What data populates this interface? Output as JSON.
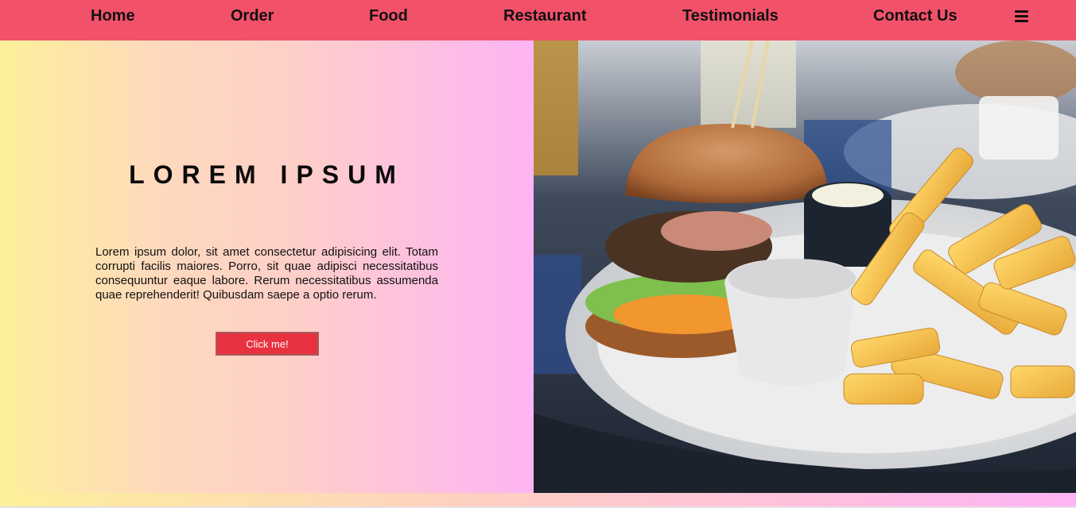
{
  "nav": {
    "items": [
      {
        "label": "Home"
      },
      {
        "label": "Order"
      },
      {
        "label": "Food"
      },
      {
        "label": "Restaurant"
      },
      {
        "label": "Testimonials"
      },
      {
        "label": "Contact Us"
      }
    ],
    "menu_icon": "hamburger-menu-icon"
  },
  "hero": {
    "title": "LOREM IPSUM",
    "paragraph": "Lorem ipsum dolor, sit amet consectetur adipisicing elit. Totam corrupti facilis maiores. Porro, sit quae adipisci necessitatibus consequuntur eaque labore. Rerum necessitatibus assumenda quae reprehenderit! Quibusdam saepe a optio rerum.",
    "button_label": "Click me!"
  },
  "colors": {
    "nav_bg": "#f2516a",
    "button_bg": "#e8323f",
    "gradient_start": "#fdf09a",
    "gradient_end": "#fdb4f4"
  }
}
